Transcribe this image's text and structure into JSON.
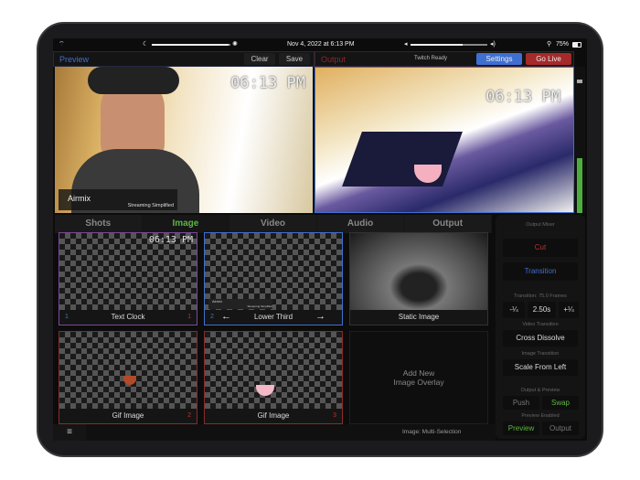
{
  "status": {
    "datetime": "Nov 4, 2022 at 6:13 PM",
    "battery": "75%",
    "brightness": 0.9,
    "volume": 0.7
  },
  "preview": {
    "title": "Preview",
    "clear": "Clear",
    "save": "Save",
    "lower_third_name": "Airmix",
    "lower_third_sub": "Streaming Simplified",
    "clock": "06:13 PM"
  },
  "output": {
    "title": "Output",
    "stream_status": "Twitch Ready",
    "settings": "Settings",
    "go_live": "Go Live",
    "clock": "06:13 PM"
  },
  "tabs": [
    "Shots",
    "Image",
    "Video",
    "Audio",
    "Output"
  ],
  "active_tab": "Image",
  "cells": [
    {
      "label": "Text Clock",
      "left_num": "1",
      "right_num": "1",
      "clock": "06:13 PM"
    },
    {
      "label": "Lower Third",
      "left_num": "2",
      "mini_name": "Airmix",
      "mini_sub": "Streaming Simplified"
    },
    {
      "label": "Static Image"
    },
    {
      "label": "Gif Image",
      "right_num": "2"
    },
    {
      "label": "Gif Image",
      "right_num": "3"
    },
    {
      "label": "Add New\nImage Overlay"
    }
  ],
  "bottom": {
    "selection": "Image: Multi-Selection"
  },
  "mixer": {
    "title": "Output Mixer",
    "cut": "Cut",
    "transition": "Transition",
    "transition_label": "Transition: 75.0 Frames",
    "minus": "-¼",
    "duration": "2.50s",
    "plus": "+¼",
    "video_transition_label": "Video Transition",
    "video_transition": "Cross Dissolve",
    "image_transition_label": "Image Transition",
    "image_transition": "Scale From Left",
    "op_label": "Output & Preview",
    "push": "Push",
    "swap": "Swap",
    "preview_enabled_label": "Preview Enabled",
    "preview": "Preview",
    "output": "Output"
  },
  "colors": {
    "blue": "#3f6fd0",
    "red": "#b83232",
    "green": "#5fb443"
  }
}
